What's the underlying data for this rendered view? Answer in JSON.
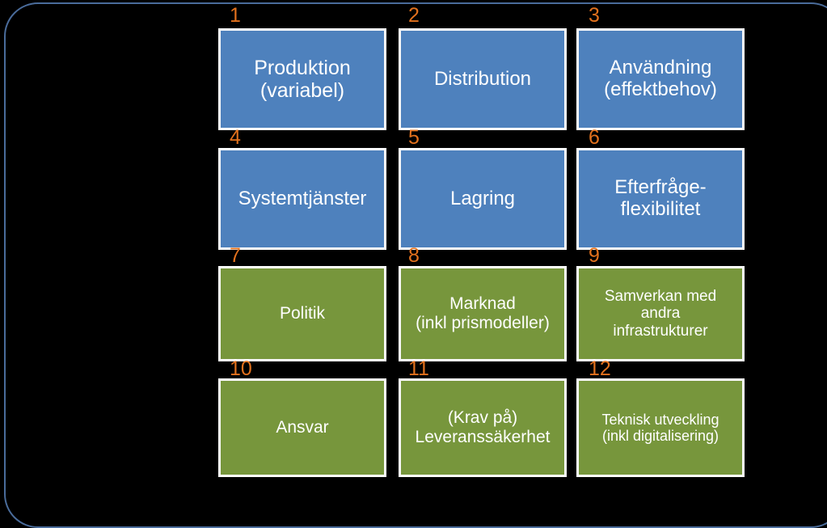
{
  "slide": {
    "background_color": "#000000",
    "frame_color": "#4a6c9b",
    "blue_color": "#4e81bd",
    "green_color": "#77963c",
    "number_color": "#e2711d",
    "box_border_color": "#ffffff"
  },
  "boxes": [
    {
      "number": "1",
      "label": "Produktion\n(variabel)",
      "color": "blue",
      "row": 1,
      "col": 1
    },
    {
      "number": "2",
      "label": "Distribution",
      "color": "blue",
      "row": 1,
      "col": 2
    },
    {
      "number": "3",
      "label": "Användning\n(effektbehov)",
      "color": "blue",
      "row": 1,
      "col": 3
    },
    {
      "number": "4",
      "label": "Systemtjänster",
      "color": "blue",
      "row": 2,
      "col": 1
    },
    {
      "number": "5",
      "label": "Lagring",
      "color": "blue",
      "row": 2,
      "col": 2
    },
    {
      "number": "6",
      "label": "Efterfråge-\nflexibilitet",
      "color": "blue",
      "row": 2,
      "col": 3
    },
    {
      "number": "7",
      "label": "Politik",
      "color": "green",
      "row": 3,
      "col": 1
    },
    {
      "number": "8",
      "label": "Marknad\n(inkl prismodeller)",
      "color": "green",
      "row": 3,
      "col": 2
    },
    {
      "number": "9",
      "label": "Samverkan med\nandra\ninfrastrukturer",
      "color": "green",
      "row": 3,
      "col": 3
    },
    {
      "number": "10",
      "label": "Ansvar",
      "color": "green",
      "row": 4,
      "col": 1
    },
    {
      "number": "11",
      "label": "(Krav på)\nLeveranssäkerhet",
      "color": "green",
      "row": 4,
      "col": 2
    },
    {
      "number": "12",
      "label": "Teknisk utveckling\n(inkl digitalisering)",
      "color": "green",
      "row": 4,
      "col": 3
    }
  ]
}
